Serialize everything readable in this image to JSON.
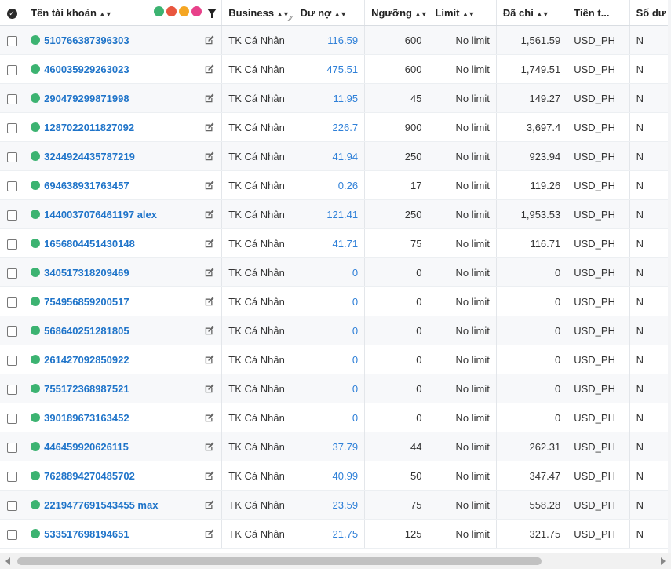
{
  "columns": {
    "name": "Tên tài khoản",
    "business": "Business",
    "debt": "Dư nợ",
    "threshold": "Ngưỡng",
    "limit": "Limit",
    "spent": "Đã chi",
    "currency": "Tiền t...",
    "balance": "Số dư"
  },
  "icons": {
    "select_all": "check-circle-icon",
    "sort": "sort-arrows-icon",
    "filter": "filter-funnel-icon",
    "edit": "pencil-square-icon",
    "status": "status-dot-icon"
  },
  "status_filter_colors": [
    "#3cb371",
    "#e8563f",
    "#f5a623",
    "#e8418a"
  ],
  "status_color": "#3cb371",
  "rows": [
    {
      "name": "510766387396303",
      "business": "TK Cá Nhân",
      "debt": "116.59",
      "threshold": "600",
      "limit": "No limit",
      "spent": "1,561.59",
      "currency": "USD_PH",
      "balance": "N"
    },
    {
      "name": "460035929263023",
      "business": "TK Cá Nhân",
      "debt": "475.51",
      "threshold": "600",
      "limit": "No limit",
      "spent": "1,749.51",
      "currency": "USD_PH",
      "balance": "N"
    },
    {
      "name": "290479299871998",
      "business": "TK Cá Nhân",
      "debt": "11.95",
      "threshold": "45",
      "limit": "No limit",
      "spent": "149.27",
      "currency": "USD_PH",
      "balance": "N"
    },
    {
      "name": "1287022011827092",
      "business": "TK Cá Nhân",
      "debt": "226.7",
      "threshold": "900",
      "limit": "No limit",
      "spent": "3,697.4",
      "currency": "USD_PH",
      "balance": "N"
    },
    {
      "name": "3244924435787219",
      "business": "TK Cá Nhân",
      "debt": "41.94",
      "threshold": "250",
      "limit": "No limit",
      "spent": "923.94",
      "currency": "USD_PH",
      "balance": "N"
    },
    {
      "name": "694638931763457",
      "business": "TK Cá Nhân",
      "debt": "0.26",
      "threshold": "17",
      "limit": "No limit",
      "spent": "119.26",
      "currency": "USD_PH",
      "balance": "N"
    },
    {
      "name": "1440037076461197 alex",
      "business": "TK Cá Nhân",
      "debt": "121.41",
      "threshold": "250",
      "limit": "No limit",
      "spent": "1,953.53",
      "currency": "USD_PH",
      "balance": "N"
    },
    {
      "name": "1656804451430148",
      "business": "TK Cá Nhân",
      "debt": "41.71",
      "threshold": "75",
      "limit": "No limit",
      "spent": "116.71",
      "currency": "USD_PH",
      "balance": "N"
    },
    {
      "name": "340517318209469",
      "business": "TK Cá Nhân",
      "debt": "0",
      "threshold": "0",
      "limit": "No limit",
      "spent": "0",
      "currency": "USD_PH",
      "balance": "N"
    },
    {
      "name": "754956859200517",
      "business": "TK Cá Nhân",
      "debt": "0",
      "threshold": "0",
      "limit": "No limit",
      "spent": "0",
      "currency": "USD_PH",
      "balance": "N"
    },
    {
      "name": "568640251281805",
      "business": "TK Cá Nhân",
      "debt": "0",
      "threshold": "0",
      "limit": "No limit",
      "spent": "0",
      "currency": "USD_PH",
      "balance": "N"
    },
    {
      "name": "261427092850922",
      "business": "TK Cá Nhân",
      "debt": "0",
      "threshold": "0",
      "limit": "No limit",
      "spent": "0",
      "currency": "USD_PH",
      "balance": "N"
    },
    {
      "name": "755172368987521",
      "business": "TK Cá Nhân",
      "debt": "0",
      "threshold": "0",
      "limit": "No limit",
      "spent": "0",
      "currency": "USD_PH",
      "balance": "N"
    },
    {
      "name": "390189673163452",
      "business": "TK Cá Nhân",
      "debt": "0",
      "threshold": "0",
      "limit": "No limit",
      "spent": "0",
      "currency": "USD_PH",
      "balance": "N"
    },
    {
      "name": "446459920626115",
      "business": "TK Cá Nhân",
      "debt": "37.79",
      "threshold": "44",
      "limit": "No limit",
      "spent": "262.31",
      "currency": "USD_PH",
      "balance": "N"
    },
    {
      "name": "7628894270485702",
      "business": "TK Cá Nhân",
      "debt": "40.99",
      "threshold": "50",
      "limit": "No limit",
      "spent": "347.47",
      "currency": "USD_PH",
      "balance": "N"
    },
    {
      "name": "2219477691543455 max",
      "business": "TK Cá Nhân",
      "debt": "23.59",
      "threshold": "75",
      "limit": "No limit",
      "spent": "558.28",
      "currency": "USD_PH",
      "balance": "N"
    },
    {
      "name": "533517698194651",
      "business": "TK Cá Nhân",
      "debt": "21.75",
      "threshold": "125",
      "limit": "No limit",
      "spent": "321.75",
      "currency": "USD_PH",
      "balance": "N"
    }
  ]
}
